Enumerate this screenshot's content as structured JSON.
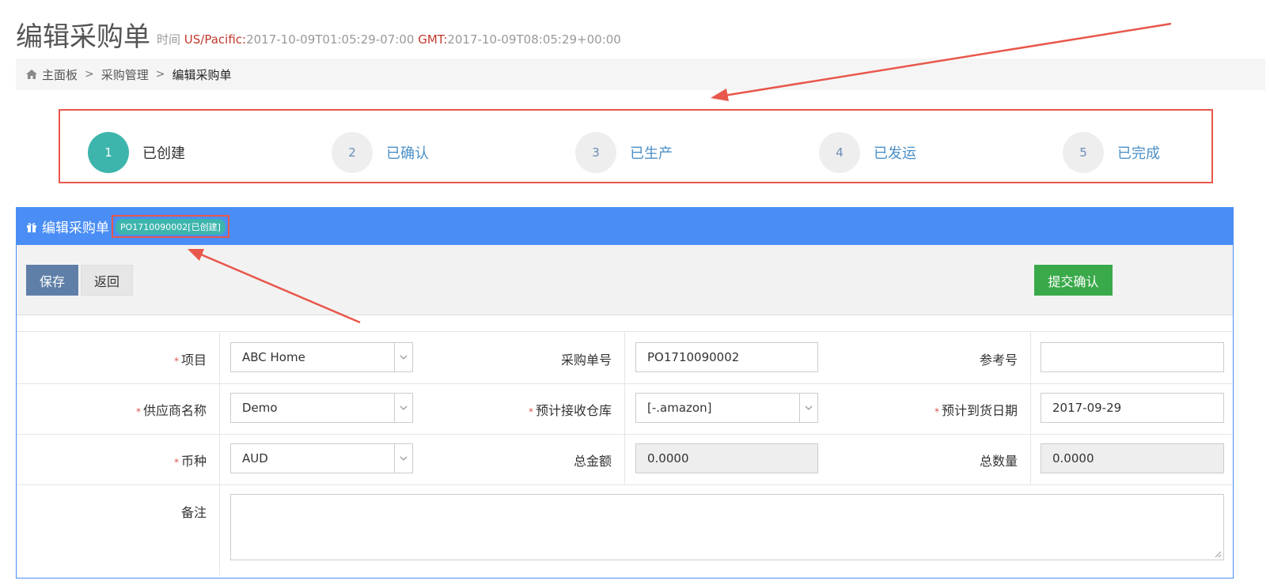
{
  "header": {
    "title": "编辑采购单",
    "time_label": "时间",
    "tz1_label": "US/Pacific:",
    "tz1_value": "2017-10-09T01:05:29-07:00",
    "tz2_label": "GMT:",
    "tz2_value": "2017-10-09T08:05:29+00:00"
  },
  "breadcrumb": {
    "home": "主面板",
    "section": "采购管理",
    "current": "编辑采购单",
    "separator": ">"
  },
  "steps": [
    {
      "num": "1",
      "label": "已创建",
      "active": true
    },
    {
      "num": "2",
      "label": "已确认",
      "active": false
    },
    {
      "num": "3",
      "label": "已生产",
      "active": false
    },
    {
      "num": "4",
      "label": "已发运",
      "active": false
    },
    {
      "num": "5",
      "label": "已完成",
      "active": false
    }
  ],
  "panel": {
    "title": "编辑采购单",
    "badge": "PO1710090002[已创建]"
  },
  "toolbar": {
    "save_label": "保存",
    "back_label": "返回",
    "submit_label": "提交确认"
  },
  "form": {
    "required_mark": "*",
    "project_label": "项目",
    "project_value": "ABC Home",
    "po_number_label": "采购单号",
    "po_number_value": "PO1710090002",
    "ref_label": "参考号",
    "ref_value": "",
    "supplier_label": "供应商名称",
    "supplier_value": "Demo",
    "warehouse_label": "预计接收仓库",
    "warehouse_value": "[-.amazon]",
    "arrival_label": "预计到货日期",
    "arrival_value": "2017-09-29",
    "currency_label": "币种",
    "currency_value": "AUD",
    "total_amount_label": "总金额",
    "total_amount_value": "0.0000",
    "total_qty_label": "总数量",
    "total_qty_value": "0.0000",
    "remarks_label": "备注"
  },
  "colors": {
    "panel_blue": "#4a8ef5",
    "active_step": "#3db5ad",
    "submit_green": "#3aa94a",
    "annotation_red": "#e8574b"
  }
}
